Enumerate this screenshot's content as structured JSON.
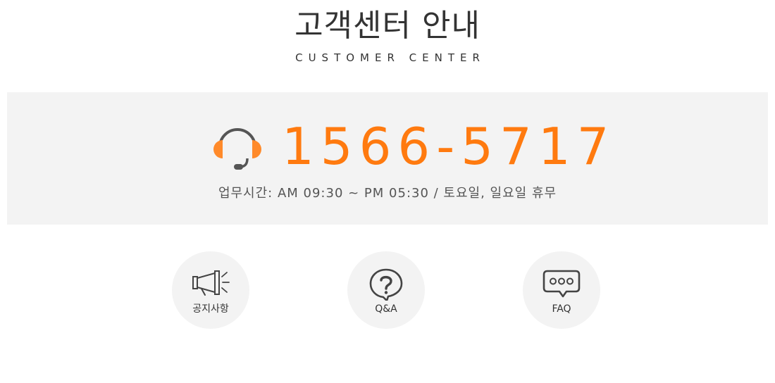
{
  "header": {
    "title": "고객센터 안내",
    "subtitle": "CUSTOMER CENTER"
  },
  "phone_panel": {
    "icon": "headset-icon",
    "number": "1566-5717",
    "hours": "업무시간: AM 09:30 ~ PM 05:30 / 토요일, 일요일 휴무"
  },
  "quick_links": [
    {
      "icon": "megaphone-icon",
      "label": "공지사항"
    },
    {
      "icon": "question-bubble-icon",
      "label": "Q&A"
    },
    {
      "icon": "chat-bubble-dots-icon",
      "label": "FAQ"
    }
  ],
  "colors": {
    "accent": "#ff7a0f",
    "panel_bg": "#f3f3f3",
    "text": "#333333",
    "icon_stroke": "#444444"
  }
}
